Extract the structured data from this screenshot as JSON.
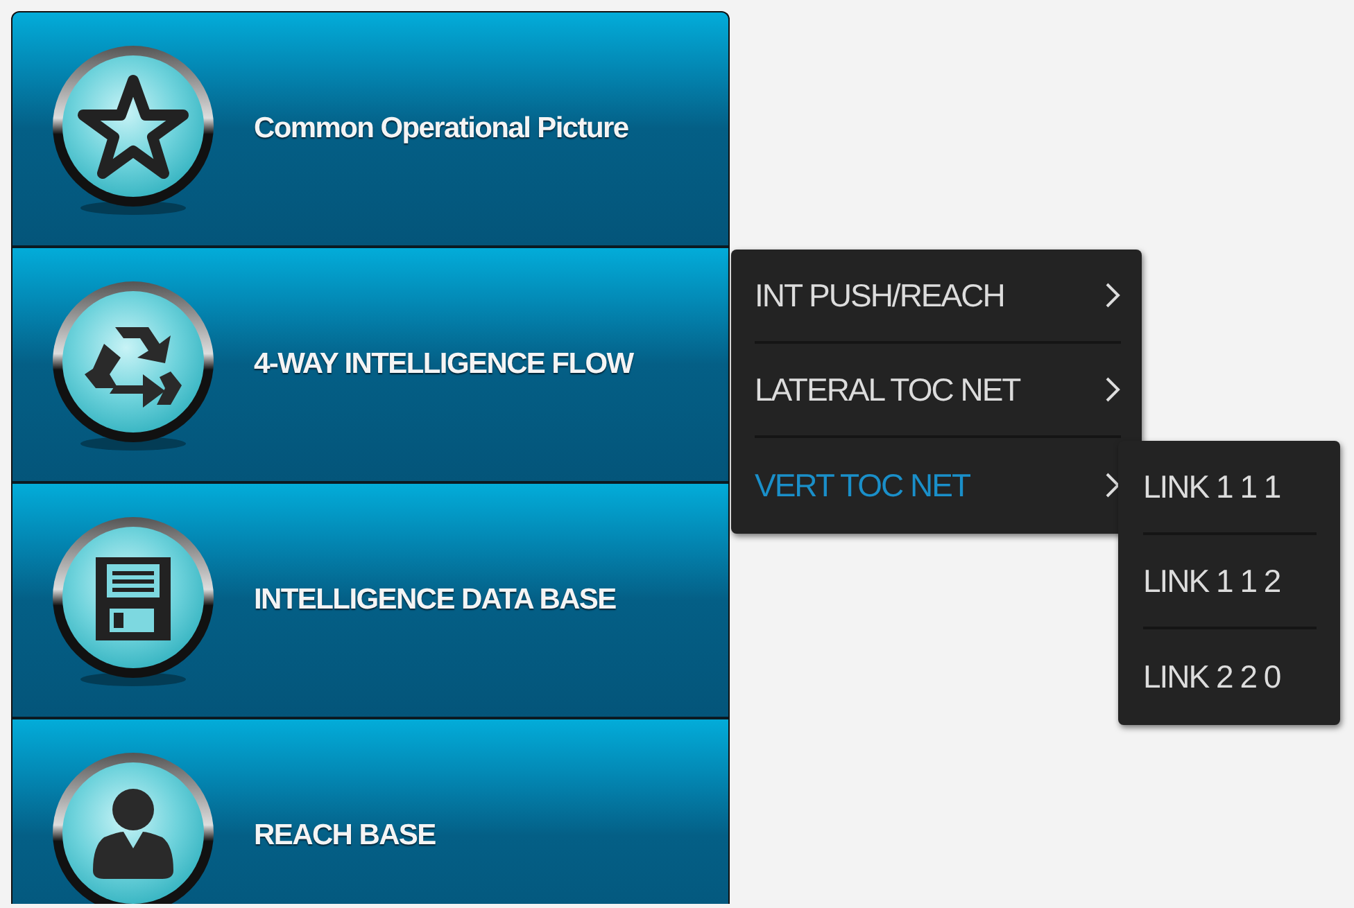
{
  "main_menu": {
    "items": [
      {
        "label": "Common Operational Picture"
      },
      {
        "label": "4-WAY INTELLIGENCE FLOW"
      },
      {
        "label": "INTELLIGENCE DATA BASE"
      },
      {
        "label": "REACH BASE"
      }
    ]
  },
  "flyout_menu": {
    "items": [
      {
        "label": "INT PUSH/REACH",
        "selected": false
      },
      {
        "label": "LATERAL TOC NET",
        "selected": false
      },
      {
        "label": "VERT TOC NET",
        "selected": true
      }
    ]
  },
  "submenu": {
    "items": [
      {
        "label": "LINK 1 1 1"
      },
      {
        "label": "LINK 1 1 2"
      },
      {
        "label": "LINK 2 2 0"
      }
    ]
  }
}
